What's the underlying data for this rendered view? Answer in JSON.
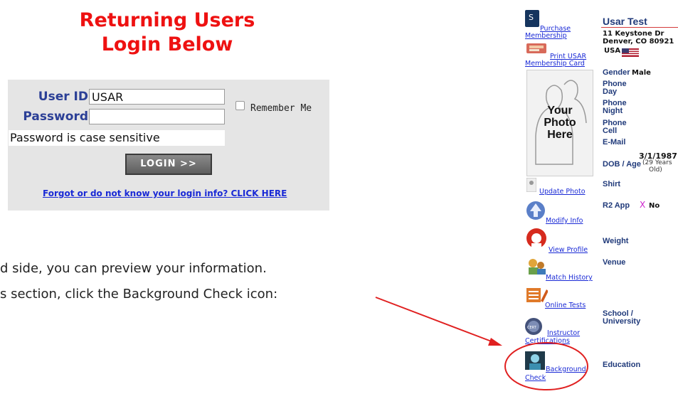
{
  "heading": {
    "line1": "Returning Users",
    "line2": "Login Below"
  },
  "login": {
    "user_id_label": "User ID",
    "user_id_value": "USAR",
    "password_label": "Password",
    "password_value": "",
    "remember_label": "Remember Me",
    "hint": "Password is case sensitive",
    "login_button": "LOGIN >>",
    "forgot_link": "Forgot or do not know your login info? CLICK HERE"
  },
  "body_text": {
    "line1": "d side, you can preview your information.",
    "line2": "s section, click the Background Check icon:"
  },
  "sidebar": {
    "purchase": "Purchase Membership",
    "purchase_l1": "Purchase",
    "purchase_l2": "Membership",
    "print_l1": "Print USAR",
    "print_l2": "Membership Card",
    "photo_l1": "Your",
    "photo_l2": "Photo",
    "photo_l3": "Here",
    "update_photo": "Update Photo",
    "modify_info": "Modify Info",
    "view_profile": "View Profile",
    "match_history": "Match History",
    "online_tests": "Online Tests",
    "instructor_l1": "Instructor",
    "instructor_l2": "Certifications",
    "background_l1": "Background",
    "background_l2": "Check"
  },
  "profile": {
    "name": "Usar Test",
    "address1": "11 Keystone Dr",
    "address2": "Denver, CO 80921",
    "country": "USA",
    "gender_label": "Gender",
    "gender_value": "Male",
    "phone_day_l1": "Phone",
    "phone_day_l2": "Day",
    "phone_night_l1": "Phone",
    "phone_night_l2": "Night",
    "phone_cell_l1": "Phone",
    "phone_cell_l2": "Cell",
    "email_label": "E-Mail",
    "dob_label": "DOB / Age",
    "dob_value": "3/1/1987",
    "age_l1": "(29 Years",
    "age_l2": "Old)",
    "shirt_label": "Shirt",
    "r2_label": "R2 App",
    "r2_mark": "X",
    "r2_value": "No",
    "weight_label": "Weight",
    "venue_label": "Venue",
    "school_l1": "School /",
    "school_l2": "University",
    "education_label": "Education"
  },
  "colors": {
    "heading": "#ee1111",
    "label_blue": "#2b3f96",
    "link": "#1a2ad6",
    "arrow": "#e02020",
    "r2_mark": "#cc22cc"
  }
}
